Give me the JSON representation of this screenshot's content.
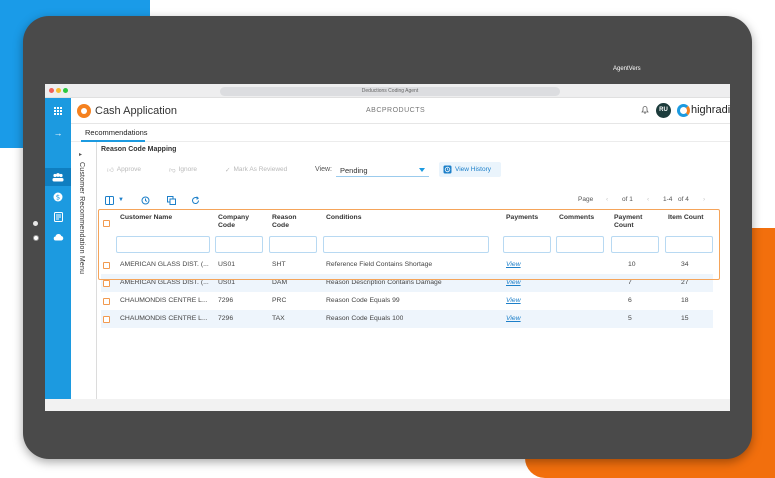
{
  "colors": {
    "accent_blue": "#1c9ae0",
    "brand_orange": "#f5811f",
    "deco_orange": "#f26f0d",
    "tablet_frame": "#4a4a4a",
    "highlight": "#f5a45a"
  },
  "browser": {
    "url_text": "Deductions Coding Agent"
  },
  "corner_text": "AgentVers",
  "header": {
    "app_title": "Cash Application",
    "company": "ABCPRODUCTS",
    "avatar_initials": "RU",
    "brand": "highradius"
  },
  "tabs": [
    {
      "label": "Recommendations",
      "active": true
    }
  ],
  "side_panel": {
    "label": "Customer Recommendation Menu"
  },
  "section_title": "Reason Code Mapping",
  "toolbar": {
    "approve": "Approve",
    "ignore": "Ignore",
    "mark_reviewed": "Mark As Reviewed",
    "view_label": "View:",
    "view_value": "Pending",
    "view_history": "View History"
  },
  "pagination": {
    "page_label": "Page",
    "page_of": "of 1",
    "range": "1-4",
    "of_total": "of 4"
  },
  "table": {
    "columns": [
      {
        "key": "customer",
        "label": "Customer Name"
      },
      {
        "key": "company",
        "label": "Company Code"
      },
      {
        "key": "reason",
        "label": "Reason Code"
      },
      {
        "key": "conditions",
        "label": "Conditions"
      },
      {
        "key": "payments",
        "label": "Payments"
      },
      {
        "key": "comments",
        "label": "Comments"
      },
      {
        "key": "payment_count",
        "label": "Payment Count"
      },
      {
        "key": "item_count",
        "label": "Item Count"
      }
    ],
    "rows": [
      {
        "customer": "AMERICAN GLASS DIST. (...",
        "company": "US01",
        "reason": "SHT",
        "conditions": "Reference Field Contains Shortage",
        "payments": "View",
        "comments": "",
        "payment_count": "10",
        "item_count": "34"
      },
      {
        "customer": "AMERICAN GLASS DIST. (...",
        "company": "US01",
        "reason": "DAM",
        "conditions": "Reason Description Contains Damage",
        "payments": "View",
        "comments": "",
        "payment_count": "7",
        "item_count": "27"
      },
      {
        "customer": "CHAUMONDIS CENTRE L...",
        "company": "7296",
        "reason": "PRC",
        "conditions": "Reason Code Equals 99",
        "payments": "View",
        "comments": "",
        "payment_count": "6",
        "item_count": "18"
      },
      {
        "customer": "CHAUMONDIS CENTRE L...",
        "company": "7296",
        "reason": "TAX",
        "conditions": "Reason Code Equals 100",
        "payments": "View",
        "comments": "",
        "payment_count": "5",
        "item_count": "15"
      }
    ]
  }
}
